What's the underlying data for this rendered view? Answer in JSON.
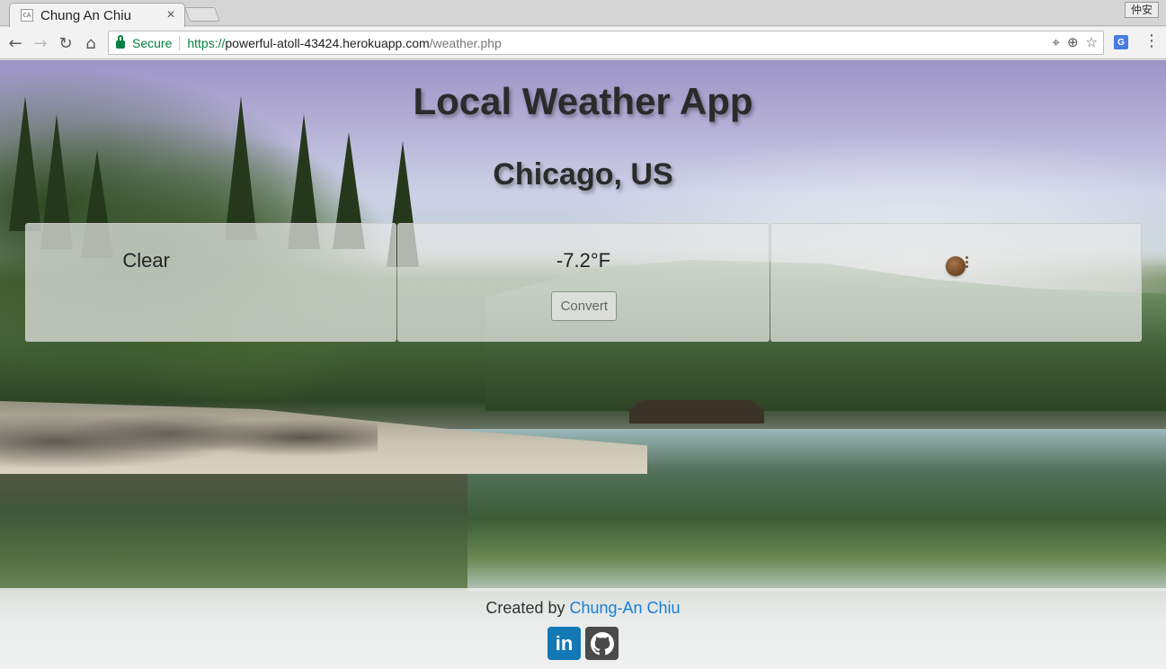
{
  "browser": {
    "tab_title": "Chung An Chiu",
    "tab_favicon_text": "CA",
    "tab_close": "×",
    "profile_name": "仲安",
    "secure_label": "Secure",
    "url_scheme": "https://",
    "url_host": "powerful-atoll-43424.herokuapp.com",
    "url_path": "/weather.php",
    "icons": [
      "back-icon",
      "forward-icon",
      "reload-icon",
      "home-icon",
      "lock-icon",
      "location-icon",
      "zoom-icon",
      "bookmark-star-icon",
      "translate-icon",
      "menu-icon"
    ]
  },
  "page": {
    "title": "Local Weather App",
    "location": "Chicago, US",
    "description": "Clear",
    "temperature": "-7.2°F",
    "convert_label": "Convert",
    "weather_icon": "clear-night-icon"
  },
  "footer": {
    "created_by": "Created by ",
    "author_link": "Chung-An Chiu",
    "social": [
      {
        "name": "linkedin-icon",
        "label": "in"
      },
      {
        "name": "github-icon"
      }
    ]
  },
  "colors": {
    "link": "#1a7ed8",
    "secure_green": "#0b8043",
    "linkedin_blue": "#1478b5",
    "github_gray": "#4a4a4a"
  }
}
